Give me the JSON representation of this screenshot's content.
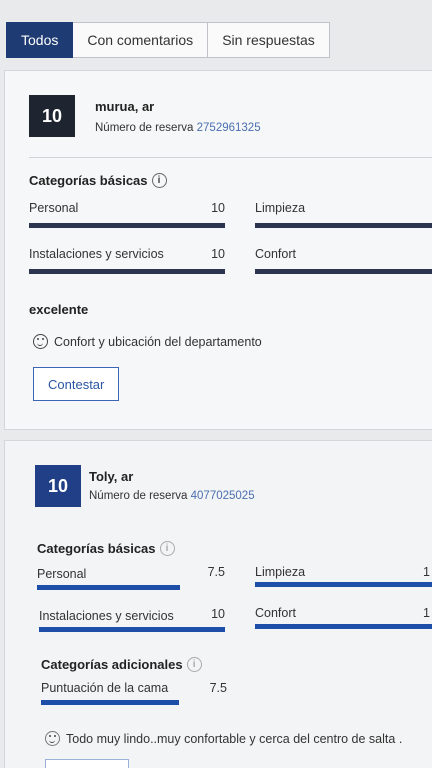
{
  "tabs": [
    {
      "label": "Todos",
      "active": true
    },
    {
      "label": "Con comentarios",
      "active": false
    },
    {
      "label": "Sin respuestas",
      "active": false
    }
  ],
  "reviews": [
    {
      "score": "10",
      "guest": "murua, ar",
      "booking_label": "Número de reserva",
      "booking_number": "2752961325",
      "basic_title": "Categorías básicas",
      "categories": [
        {
          "label": "Personal",
          "score": "10",
          "fraction": 1.0
        },
        {
          "label": "Limpieza",
          "score": "",
          "fraction": 1.0
        },
        {
          "label": "Instalaciones y servicios",
          "score": "10",
          "fraction": 1.0
        },
        {
          "label": "Confort",
          "score": "",
          "fraction": 1.0
        }
      ],
      "title": "excelente",
      "text": "Confort y ubicación del departamento",
      "reply_label": "Contestar"
    },
    {
      "score": "10",
      "guest": "Toly, ar",
      "booking_label": "Número de reserva",
      "booking_number": "4077025025",
      "basic_title": "Categorías básicas",
      "categories": [
        {
          "label": "Personal",
          "score": "7.5",
          "fraction": 0.75
        },
        {
          "label": "Limpieza",
          "score": "1",
          "fraction": 1.0
        },
        {
          "label": "Instalaciones y servicios",
          "score": "10",
          "fraction": 1.0
        },
        {
          "label": "Confort",
          "score": "1",
          "fraction": 1.0
        }
      ],
      "additional_title": "Categorías adicionales",
      "additional": [
        {
          "label": "Puntuación de la cama",
          "score": "7.5",
          "fraction": 0.75
        }
      ],
      "text": "Todo muy lindo..muy confortable y cerca del centro de salta ."
    }
  ],
  "colors": {
    "tab_active": "#1f3b73",
    "bar_dark": "#2c3550",
    "bar_blue": "#1d4fa8",
    "score_dark": "#1e2430",
    "score_blue": "#203f86"
  }
}
